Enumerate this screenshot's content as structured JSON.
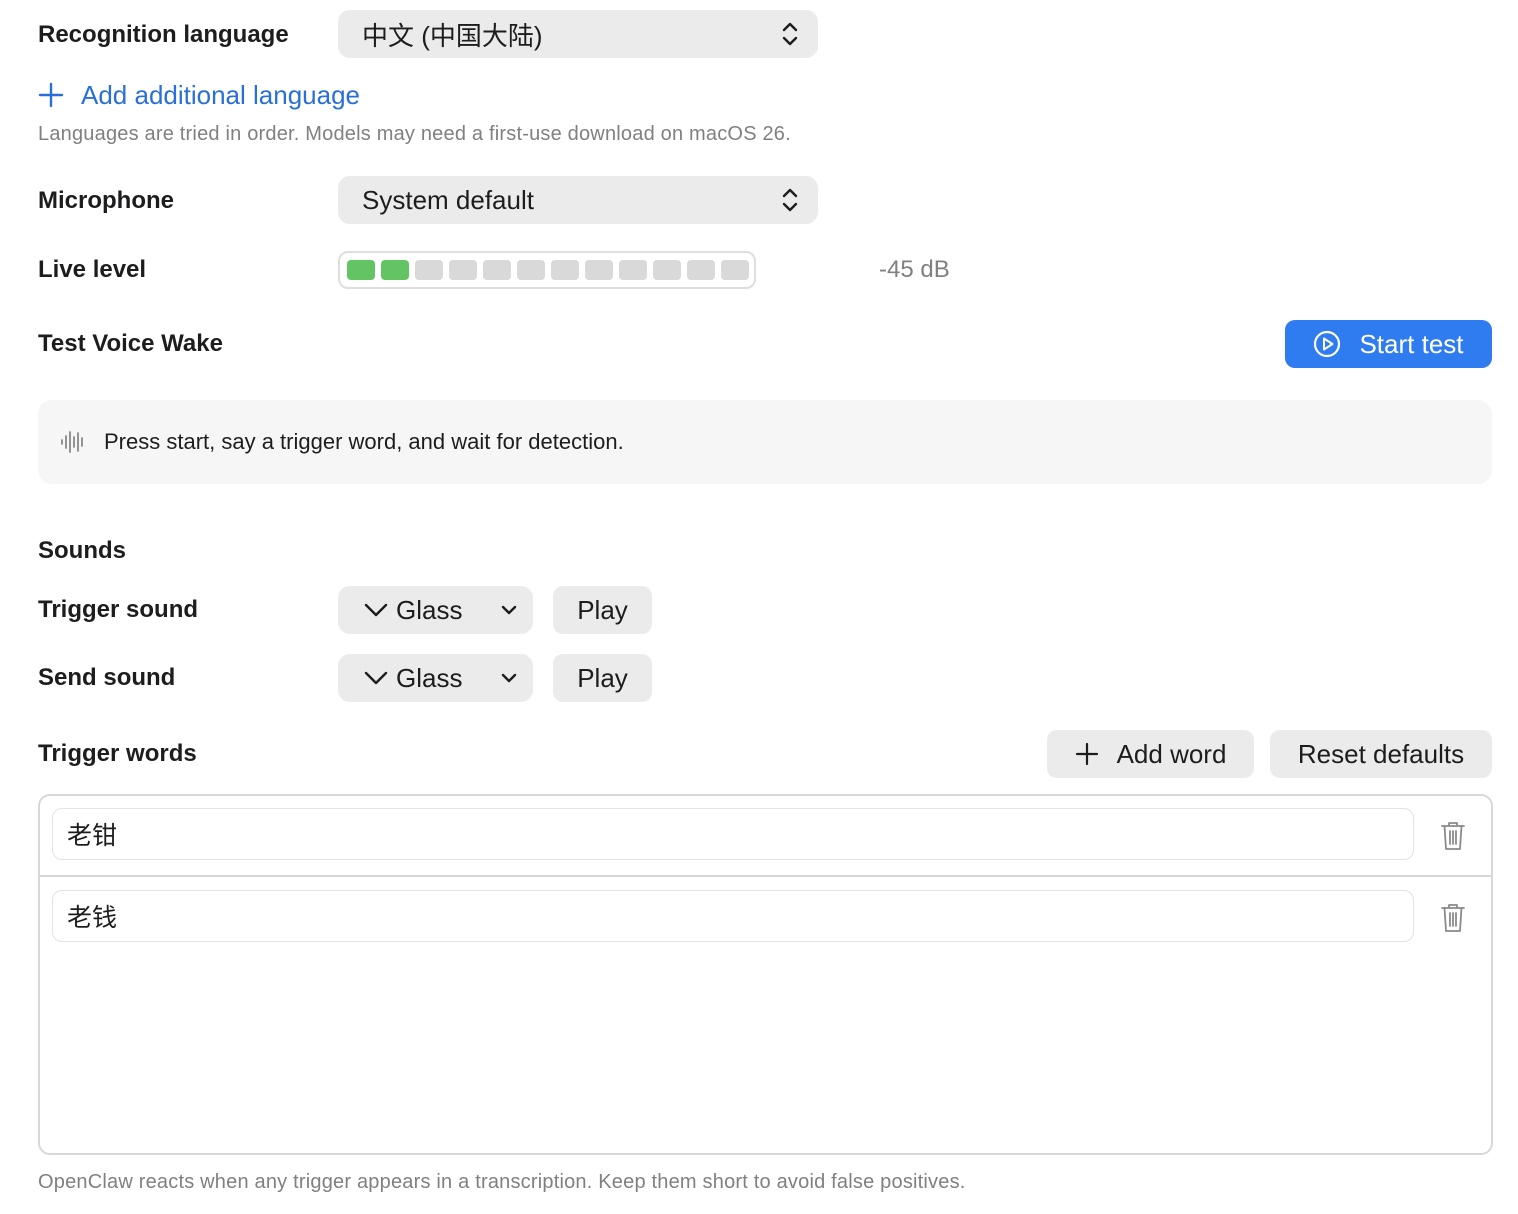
{
  "recognition": {
    "label": "Recognition language",
    "value": "中文 (中国大陆)",
    "add_language": "Add additional language",
    "hint": "Languages are tried in order. Models may need a first-use download on macOS 26."
  },
  "microphone": {
    "label": "Microphone",
    "value": "System default"
  },
  "live_level": {
    "label": "Live level",
    "segments_total": 12,
    "segments_active": 2,
    "active_color": "#62c462",
    "inactive_color": "#d9d9d9",
    "readout": "-45 dB"
  },
  "test": {
    "label": "Test Voice Wake",
    "start_button": "Start test",
    "status": "Press start, say a trigger word, and wait for detection."
  },
  "sounds": {
    "heading": "Sounds",
    "trigger": {
      "label": "Trigger sound",
      "value": "Glass",
      "play": "Play"
    },
    "send": {
      "label": "Send sound",
      "value": "Glass",
      "play": "Play"
    }
  },
  "trigger_words": {
    "label": "Trigger words",
    "add_word": "Add word",
    "reset": "Reset defaults",
    "items": [
      "老钳",
      "老钱"
    ],
    "footer": "OpenClaw reacts when any trigger appears in a transcription. Keep them short to avoid false positives."
  },
  "colors": {
    "accent": "#2f7bf0",
    "link": "#2a6fd8"
  }
}
